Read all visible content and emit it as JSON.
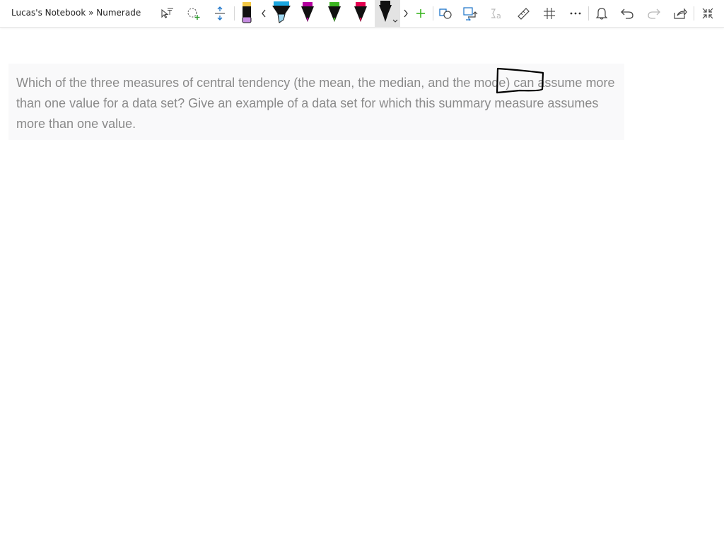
{
  "window": {
    "title": "Lucas's Notebook » Numerade"
  },
  "toolbar": {
    "tools": [
      {
        "name": "type-text-tool",
        "icon": "text-select-icon"
      },
      {
        "name": "lasso-select-tool",
        "icon": "lasso-add-icon"
      },
      {
        "name": "add-space-tool",
        "icon": "add-space-icon"
      },
      {
        "name": "eraser-tool",
        "icon": "eraser-icon"
      },
      {
        "name": "scroll-left",
        "icon": "chevron-left-icon"
      },
      {
        "name": "highlighter-blue",
        "icon": "highlighter-icon",
        "color": "#1aa6e0"
      },
      {
        "name": "pen-magenta",
        "icon": "pen-icon",
        "color": "#b4009e"
      },
      {
        "name": "pen-green",
        "icon": "pen-icon",
        "color": "#3cb521"
      },
      {
        "name": "pen-red",
        "icon": "pen-icon",
        "color": "#e3004f"
      },
      {
        "name": "pen-black",
        "icon": "pen-icon",
        "color": "#000000",
        "selected": true
      },
      {
        "name": "scroll-right",
        "icon": "chevron-right-icon"
      },
      {
        "name": "add-pen",
        "icon": "plus-icon"
      },
      {
        "name": "ink-to-shape",
        "icon": "shapes-icon"
      },
      {
        "name": "ink-to-text",
        "icon": "ink-convert-icon"
      },
      {
        "name": "ink-to-math",
        "icon": "math-icon"
      },
      {
        "name": "ruler",
        "icon": "ruler-icon"
      },
      {
        "name": "grid-lines",
        "icon": "grid-icon"
      },
      {
        "name": "more-options",
        "icon": "more-icon"
      },
      {
        "name": "notifications",
        "icon": "bell-icon"
      },
      {
        "name": "undo",
        "icon": "undo-icon"
      },
      {
        "name": "redo",
        "icon": "redo-icon"
      },
      {
        "name": "share",
        "icon": "share-icon"
      },
      {
        "name": "collapse",
        "icon": "collapse-icon"
      }
    ]
  },
  "page": {
    "question_text": "Which of the three measures of central tendency (the mean, the median, and the mode) can assume more than one value for a data set? Give an example of a data set for which this summary measure assumes more than one value."
  },
  "colors": {
    "accent_blue": "#1a73c9",
    "accent_green": "#3cb521",
    "text_gray": "#8a8a8a",
    "ink": "#000000"
  }
}
